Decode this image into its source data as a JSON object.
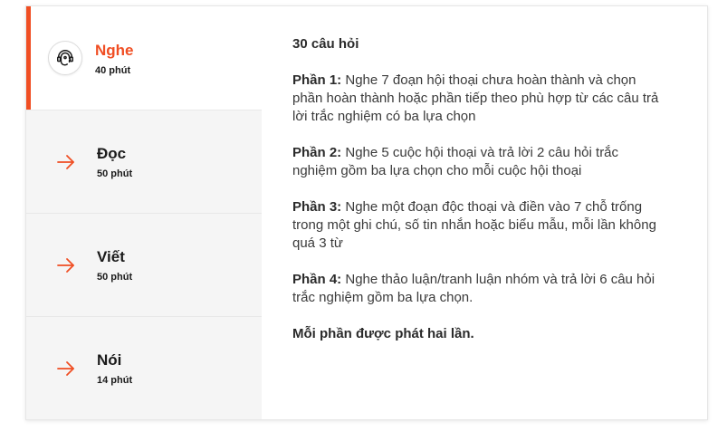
{
  "tabs": [
    {
      "id": "nghe",
      "title": "Nghe",
      "duration": "40 phút",
      "icon": "headphones-head-icon",
      "active": true
    },
    {
      "id": "doc",
      "title": "Đọc",
      "duration": "50 phút",
      "icon": "arrow-right-icon",
      "active": false
    },
    {
      "id": "viet",
      "title": "Viết",
      "duration": "50 phút",
      "icon": "arrow-right-icon",
      "active": false
    },
    {
      "id": "noi",
      "title": "Nói",
      "duration": "14 phút",
      "icon": "arrow-right-icon",
      "active": false
    }
  ],
  "content": {
    "question_count": "30 câu hỏi",
    "parts": [
      {
        "label": "Phần 1:",
        "text": "Nghe 7 đoạn hội thoại chưa hoàn thành và chọn phần hoàn thành hoặc phần tiếp theo phù hợp từ các câu trả lời trắc nghiệm có ba lựa chọn"
      },
      {
        "label": "Phần 2:",
        "text": "Nghe 5 cuộc hội thoại và trả lời 2 câu hỏi trắc nghiệm gồm ba lựa chọn cho mỗi cuộc hội thoại"
      },
      {
        "label": "Phần 3:",
        "text": "Nghe một đoạn độc thoại và điền vào 7 chỗ trống trong một ghi chú, số tin nhắn hoặc biểu mẫu, mỗi lần không quá 3 từ"
      },
      {
        "label": "Phần 4:",
        "text": "Nghe thảo luận/tranh luận nhóm và trả lời 6 câu hỏi trắc nghiệm gồm ba lựa chọn."
      }
    ],
    "note": "Mỗi phần được phát hai lần."
  },
  "colors": {
    "accent": "#f04e23",
    "sidebar_bg": "#f5f5f5",
    "text": "#3a3a3a"
  }
}
